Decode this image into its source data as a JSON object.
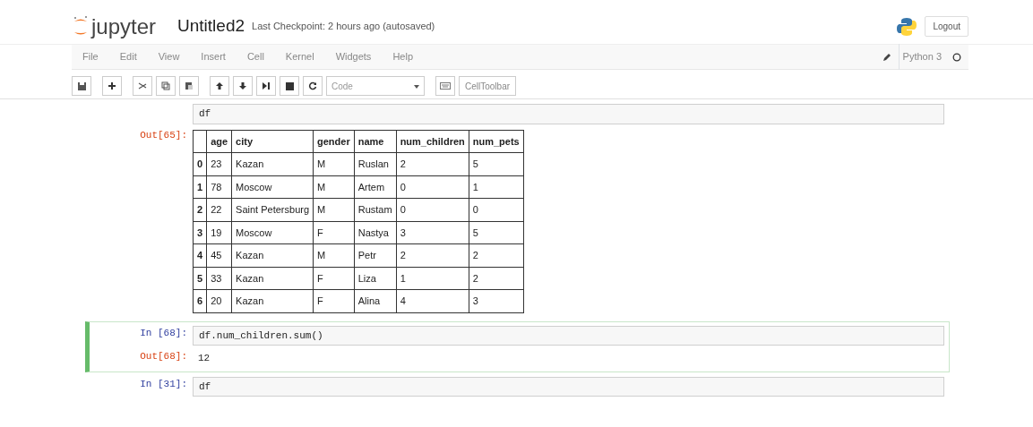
{
  "header": {
    "logo_text": "jupyter",
    "notebook_name": "Untitled2",
    "checkpoint": "Last Checkpoint: 2 hours ago (autosaved)",
    "logout": "Logout"
  },
  "menu": [
    "File",
    "Edit",
    "View",
    "Insert",
    "Cell",
    "Kernel",
    "Widgets",
    "Help"
  ],
  "kernel": {
    "name": "Python 3",
    "busy": false
  },
  "toolbar": {
    "cell_type": "Code",
    "cell_toolbar": "CellToolbar"
  },
  "cells": [
    {
      "selected": false,
      "input": "df",
      "output_prompt": "Out[65]:",
      "table": {
        "columns": [
          "",
          "age",
          "city",
          "gender",
          "name",
          "num_children",
          "num_pets"
        ],
        "rows": [
          [
            "0",
            "23",
            "Kazan",
            "M",
            "Ruslan",
            "2",
            "5"
          ],
          [
            "1",
            "78",
            "Moscow",
            "M",
            "Artem",
            "0",
            "1"
          ],
          [
            "2",
            "22",
            "Saint Petersburg",
            "M",
            "Rustam",
            "0",
            "0"
          ],
          [
            "3",
            "19",
            "Moscow",
            "F",
            "Nastya",
            "3",
            "5"
          ],
          [
            "4",
            "45",
            "Kazan",
            "M",
            "Petr",
            "2",
            "2"
          ],
          [
            "5",
            "33",
            "Kazan",
            "F",
            "Liza",
            "1",
            "2"
          ],
          [
            "6",
            "20",
            "Kazan",
            "F",
            "Alina",
            "4",
            "3"
          ]
        ]
      }
    },
    {
      "selected": true,
      "input_prompt": "In [68]:",
      "input": "df.num_children.sum()",
      "output_prompt": "Out[68]:",
      "output": "12"
    },
    {
      "selected": false,
      "input_prompt": "In [31]:",
      "input": "df"
    }
  ]
}
